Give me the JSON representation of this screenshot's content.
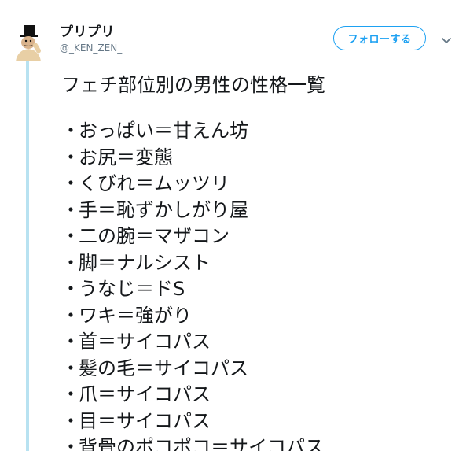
{
  "user": {
    "display_name": "プリプリ",
    "username": "@_KEN_ZEN_"
  },
  "follow_label": "フォローする",
  "menu_icon": "chevron-down-icon",
  "tweet": {
    "title": "フェチ部位別の男性の性格一覧",
    "bullet": "・",
    "items": [
      "おっぱい＝甘えん坊",
      "お尻＝変態",
      "くびれ＝ムッツリ",
      "手＝恥ずかしがり屋",
      "二の腕＝マザコン",
      "脚＝ナルシスト",
      "うなじ＝ドS",
      "ワキ＝強がり",
      "首＝サイコパス",
      "髪の毛＝サイコパス",
      "爪＝サイコパス",
      "目＝サイコパス",
      "背骨のポコポコ＝サイコパス"
    ]
  },
  "colors": {
    "accent": "#1da1f2",
    "thread_line": "#b8e2f1",
    "text": "#14171a",
    "muted": "#657786"
  }
}
